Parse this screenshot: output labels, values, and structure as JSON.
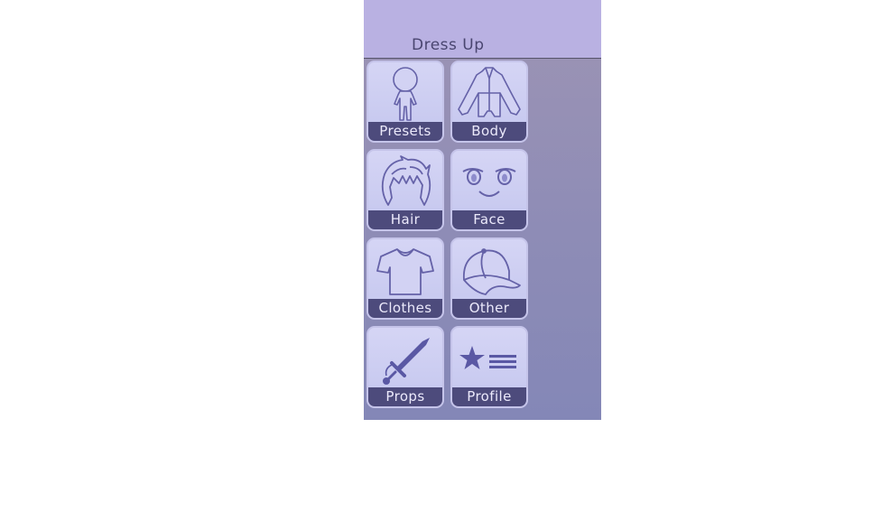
{
  "header": {
    "title": "Dress Up"
  },
  "tiles": [
    {
      "label": "Presets",
      "icon": "chibi-figure-icon"
    },
    {
      "label": "Body",
      "icon": "body-suit-icon"
    },
    {
      "label": "Hair",
      "icon": "hair-icon"
    },
    {
      "label": "Face",
      "icon": "face-icon"
    },
    {
      "label": "Clothes",
      "icon": "t-shirt-icon"
    },
    {
      "label": "Other",
      "icon": "cap-icon"
    },
    {
      "label": "Props",
      "icon": "sword-icon"
    },
    {
      "label": "Profile",
      "icon": "star-list-icon"
    }
  ],
  "colors": {
    "header_bg": "#b9b1e2",
    "panel_bg": "#9293b6",
    "tile_bg": "#d0d0f3",
    "label_bg": "#4d4b7c",
    "icon": "#5a58a4"
  }
}
